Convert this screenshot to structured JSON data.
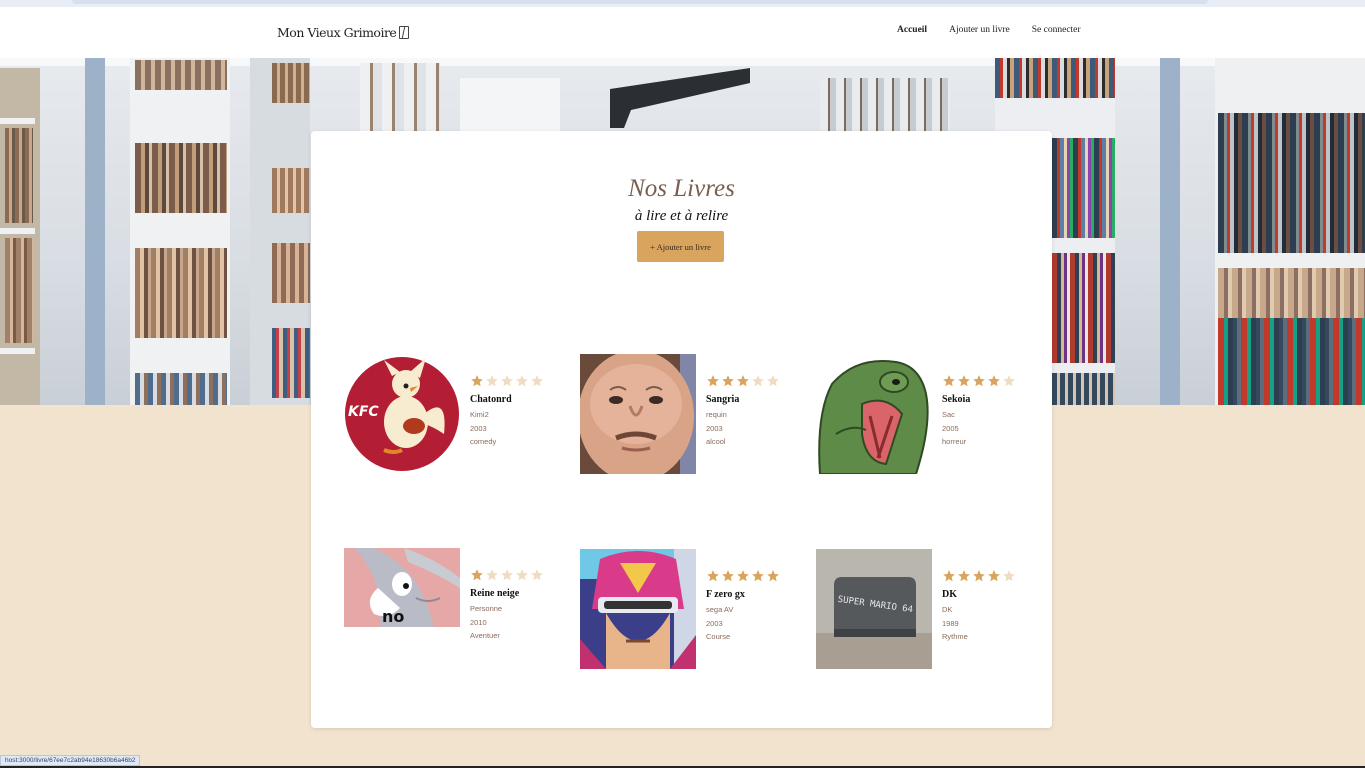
{
  "header": {
    "brand": "Mon Vieux Grimoire",
    "nav": [
      {
        "label": "Accueil",
        "active": true
      },
      {
        "label": "Ajouter un livre",
        "active": false
      },
      {
        "label": "Se connecter",
        "active": false
      }
    ]
  },
  "main": {
    "title": "Nos Livres",
    "subtitle": "à lire et à relire",
    "add_button": "+ Ajouter un livre"
  },
  "books": [
    {
      "title": "Chatonrd",
      "author": "Kimi2",
      "year": "2003",
      "genre": "comedy",
      "rating": 1
    },
    {
      "title": "Sangria",
      "author": "requin",
      "year": "2003",
      "genre": "alcool",
      "rating": 3
    },
    {
      "title": "Sekoia",
      "author": "Sac",
      "year": "2005",
      "genre": "horreur",
      "rating": 4
    },
    {
      "title": "Reine neige",
      "author": "Personne",
      "year": "2010",
      "genre": "Aventuer",
      "rating": 1
    },
    {
      "title": "F zero gx",
      "author": "sega AV",
      "year": "2003",
      "genre": "Course",
      "rating": 5
    },
    {
      "title": "DK",
      "author": "DK",
      "year": "1989",
      "genre": "Rythme",
      "rating": 4
    }
  ],
  "thumb_text": {
    "kfc": "KFC",
    "no": "no",
    "cart": "SUPER MARIO 64"
  },
  "status_bar": "host:3000/livre/67ee7c2ab94e18630b6a46b2",
  "colors": {
    "accent": "#d9a45e",
    "star_on": "#d9a45e",
    "star_off": "#f0dcc0",
    "page_bg": "#f2e3cf",
    "title_brown": "#7a5e50"
  }
}
